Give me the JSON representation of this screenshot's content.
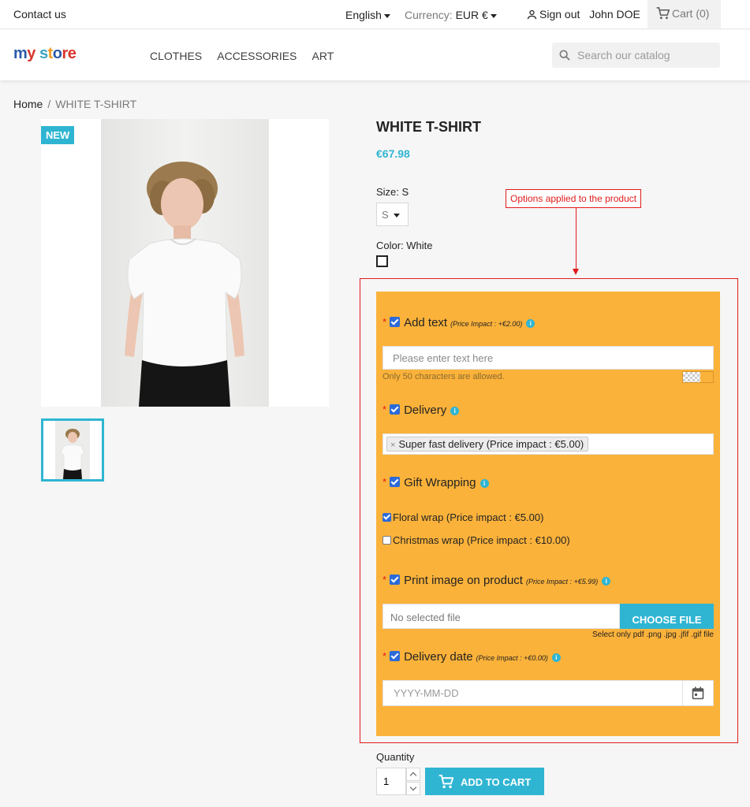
{
  "topbar": {
    "contact": "Contact us",
    "language": "English",
    "currency_label": "Currency:",
    "currency_value": "EUR €",
    "sign_out": "Sign out",
    "user_name": "John DOE",
    "cart": "Cart (0)"
  },
  "header": {
    "logo": [
      "m",
      "y",
      " ",
      "s",
      "t",
      "o",
      "re"
    ],
    "nav": [
      "CLOTHES",
      "ACCESSORIES",
      "ART"
    ],
    "search_placeholder": "Search our catalog"
  },
  "breadcrumb": {
    "home": "Home",
    "separator": "/",
    "current": "WHITE T-SHIRT"
  },
  "product": {
    "badge": "NEW",
    "title": "WHITE T-SHIRT",
    "price": "€67.98",
    "size_label": "Size: S",
    "size_value": "S",
    "color_label": "Color: White",
    "color_value": "#ffffff"
  },
  "annotation": {
    "label": "Options applied to the product",
    "color": "#e11b1b"
  },
  "options": {
    "panel_color": "#fbb23a",
    "add_text": {
      "title": "Add text",
      "impact": "(Price Impact : +€2.00)",
      "placeholder": "Please enter text here",
      "hint": "Only 50 characters are allowed."
    },
    "delivery": {
      "title": "Delivery",
      "selected_tag": "Super fast delivery (Price impact : €5.00)",
      "tag_remove": "×"
    },
    "gift_wrapping": {
      "title": "Gift Wrapping",
      "choices": [
        {
          "label": "Floral wrap (Price impact : €5.00)",
          "checked": true
        },
        {
          "label": "Christmas wrap (Price impact : €10.00)",
          "checked": false
        }
      ]
    },
    "print_image": {
      "title": "Print image on product",
      "impact": "(Price Impact : +€5.99)",
      "file_placeholder": "No selected file",
      "button": "CHOOSE FILE",
      "hint": "Select only pdf .png .jpg .jfif .gif file"
    },
    "delivery_date": {
      "title": "Delivery date",
      "impact": "(Price Impact : +€0.00)",
      "placeholder": "YYYY-MM-DD"
    },
    "required_mark": "*",
    "info_glyph": "i"
  },
  "purchase": {
    "quantity_label": "Quantity",
    "quantity_value": "1",
    "add_to_cart": "ADD TO CART"
  },
  "colors": {
    "accent": "#2fb5d2",
    "checkbox": "#2b6ad8"
  }
}
